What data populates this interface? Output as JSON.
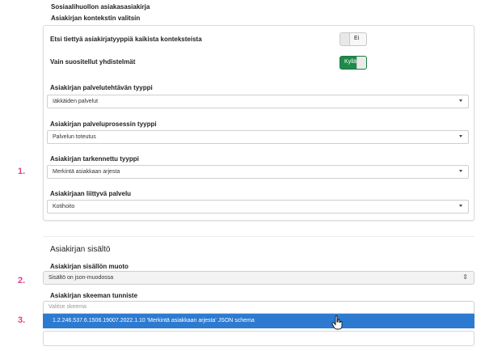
{
  "header": {
    "title": "Sosiaalihuollon asiakasasiakirja",
    "subtitle": "Asiakirjan kontekstin valitsin"
  },
  "context": {
    "search_all": {
      "label": "Etsi tiettyä asiakirjatyyppiä kaikista konteksteista",
      "value": "Ei"
    },
    "recommended_only": {
      "label": "Vain suositellut yhdistelmät",
      "value": "Kyllä"
    },
    "service_task_type": {
      "label": "Asiakirjan palvelutehtävän tyyppi",
      "value": "Iäkkäiden palvelut"
    },
    "service_process_type": {
      "label": "Asiakirjan palveluprosessin tyyppi",
      "value": "Palvelun toteutus"
    },
    "specific_type": {
      "label": "Asiakirjan tarkennettu tyyppi",
      "value": "Merkintä asiakkaan arjesta"
    },
    "related_service": {
      "label": "Asiakirjaan liittyvä palvelu",
      "value": "Kotihoito"
    }
  },
  "steps": {
    "one": "1.",
    "two": "2.",
    "three": "3."
  },
  "content": {
    "heading": "Asiakirjan sisältö",
    "format": {
      "label": "Asiakirjan sisällön muoto",
      "value": "Sisältö on json-muodossa"
    },
    "schema": {
      "label": "Asiakirjan skeeman tunniste",
      "placeholder": "Valitse skeema",
      "option": "1.2.246.537.6.1506.19007.2022.1.10 'Merkintä asiakkaan arjesta' JSON schema"
    }
  },
  "colors": {
    "toggle_on": "#1f8a4a",
    "step_marker": "#e0408a",
    "highlight": "#2d7bd1"
  }
}
